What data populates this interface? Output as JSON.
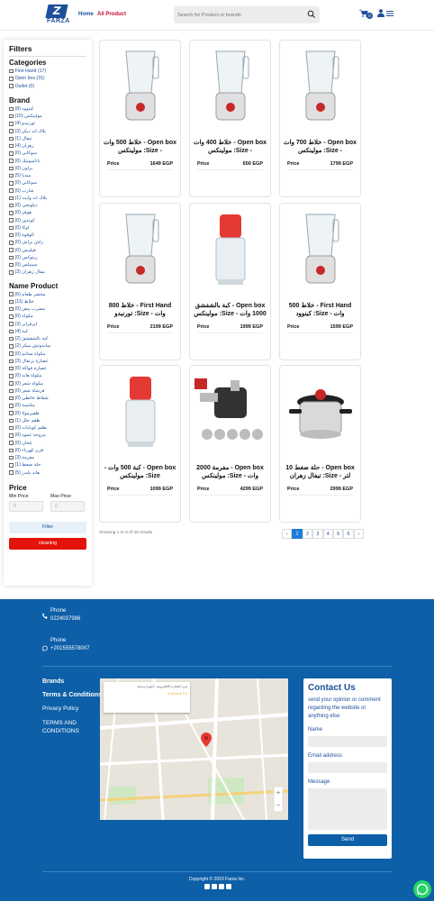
{
  "header": {
    "logo_text": "FARZA",
    "logo_letter": "Z",
    "nav": {
      "home": "Home",
      "all_product": "All Product"
    },
    "search_placeholder": "Search for Product or brands",
    "cart_count": "0"
  },
  "sidebar": {
    "title": "Filters",
    "categories_title": "Categories",
    "categories": [
      "First Hand (17)",
      "Open box (31)",
      "Outlet (0)"
    ],
    "brand_title": "Brand",
    "brands": [
      "كينوود (8)",
      "مولينكس (15)",
      "تورنيدو (4)",
      "بلاك اند ديكر (3)",
      "تيفال (1)",
      "زهران (4)",
      "سوكاني (0)",
      "باناسونيك (0)",
      "براون (0)",
      "ميديا (5)",
      "سوكاني (0)",
      "شارب (0)",
      "بلاك اند وايت (1)",
      "ديلونجي (0)",
      "هوفر (0)",
      "كوندور (0)",
      "اوكا (0)",
      "الوقوة (0)",
      "راش براش (0)",
      "فيليبس (0)",
      "زينوكس (0)",
      "سينيلس (0)",
      "تيفال زهران (3)"
    ],
    "name_title": "Name Product",
    "names": [
      "محضر طعام (6)",
      "خلاط (11)",
      "مضرب بيض (0)",
      "مكواة (0)",
      "ايرفراير (3)",
      "كبة (4)",
      "كبة بالشفشق (2)",
      "ساندوتش ميكر (2)",
      "مكواة ستانم (0)",
      "عصارة برتقال (3)",
      "عصارة فواكة (0)",
      "مكواة هاند (0)",
      "مكواة شعر (0)",
      "فرشاة شعر (0)",
      "شفاط حائطي (0)",
      "مكنسة (0)",
      "ظفيرمولا (0)",
      "طقم حلل (1)",
      "طقم كوبايات (0)",
      "مروحة عمود (0)",
      "عجان (0)",
      "فرن كهرباء (0)",
      "مفرمة (3)",
      "حلة ضغط (1)",
      "هاند بلندر (5)"
    ],
    "price_title": "Price",
    "min_label": "Min Price",
    "max_label": "Max Price",
    "min_value": "0",
    "max_value": "0",
    "filter_label": "Filter",
    "cleaning_label": "cleaning"
  },
  "products": [
    {
      "title": "Open box - خلاط 500 وات - Size: مولينكس",
      "price_label": "Price",
      "price": "1649 EGP",
      "icon": "blender-icon"
    },
    {
      "title": "Open box - خلاط 400 وات - Size: مولينكس",
      "price_label": "Price",
      "price": "650 EGP",
      "icon": "blender-icon"
    },
    {
      "title": "Open box - خلاط 700 وات - Size: مولينكس",
      "price_label": "Price",
      "price": "1799 EGP",
      "icon": "blender-icon"
    },
    {
      "title": "First Hand - خلاط 800 وات - Size: تورنيدو",
      "price_label": "Price",
      "price": "2199 EGP",
      "icon": "blender-icon"
    },
    {
      "title": "Open box - كبة بالشفشق 1000 وات - Size: مولينكس",
      "price_label": "Price",
      "price": "1999 EGP",
      "icon": "chopper-icon"
    },
    {
      "title": "First Hand - خلاط 500 وات - Size: كينوود",
      "price_label": "Price",
      "price": "1599 EGP",
      "icon": "blender-icon"
    },
    {
      "title": "Open box - كبة 500 وات - Size: مولينكس",
      "price_label": "Price",
      "price": "1099 EGP",
      "icon": "chopper-icon"
    },
    {
      "title": "Open box - مفرمة 2000 وات - Size: مولينكس",
      "price_label": "Price",
      "price": "4299 EGP",
      "icon": "meat-grinder-icon"
    },
    {
      "title": "Open box - حلة ضغط 10 لتر - Size: تيفال زهران",
      "price_label": "Price",
      "price": "2999 EGP",
      "icon": "pressure-cooker-icon"
    }
  ],
  "results_text": "Showing 1 to 9 of 48 results",
  "pagination": [
    "‹",
    "1",
    "2",
    "3",
    "4",
    "5",
    "6",
    "›"
  ],
  "footer": {
    "phones": [
      {
        "label": "Phone",
        "number": "0224037986"
      },
      {
        "label": "Phone",
        "number": "+201555578007"
      }
    ],
    "links": [
      "Brands",
      "Terms & Conditions",
      "Privacy Policy",
      "TERMS AND CONDITIONS"
    ],
    "map_card": {
      "title": "فرزا للتجارة الإلكترونية - أجهزة منزلية",
      "rating": "5.0",
      "stars": "★★★★★"
    },
    "contact": {
      "title": "Contact Us",
      "subtitle": "send your opinion or comment regarding the website or anything else",
      "name_label": "Name",
      "email_label": "Email address",
      "message_label": "Message",
      "send_label": "Send"
    },
    "copyright": "Copyright © 2023 Farza Inc."
  },
  "colors": {
    "brand": "#1d4f9a",
    "accent_red": "#e3120b",
    "footer_bg": "#0d5fa8",
    "whatsapp": "#25d366"
  }
}
